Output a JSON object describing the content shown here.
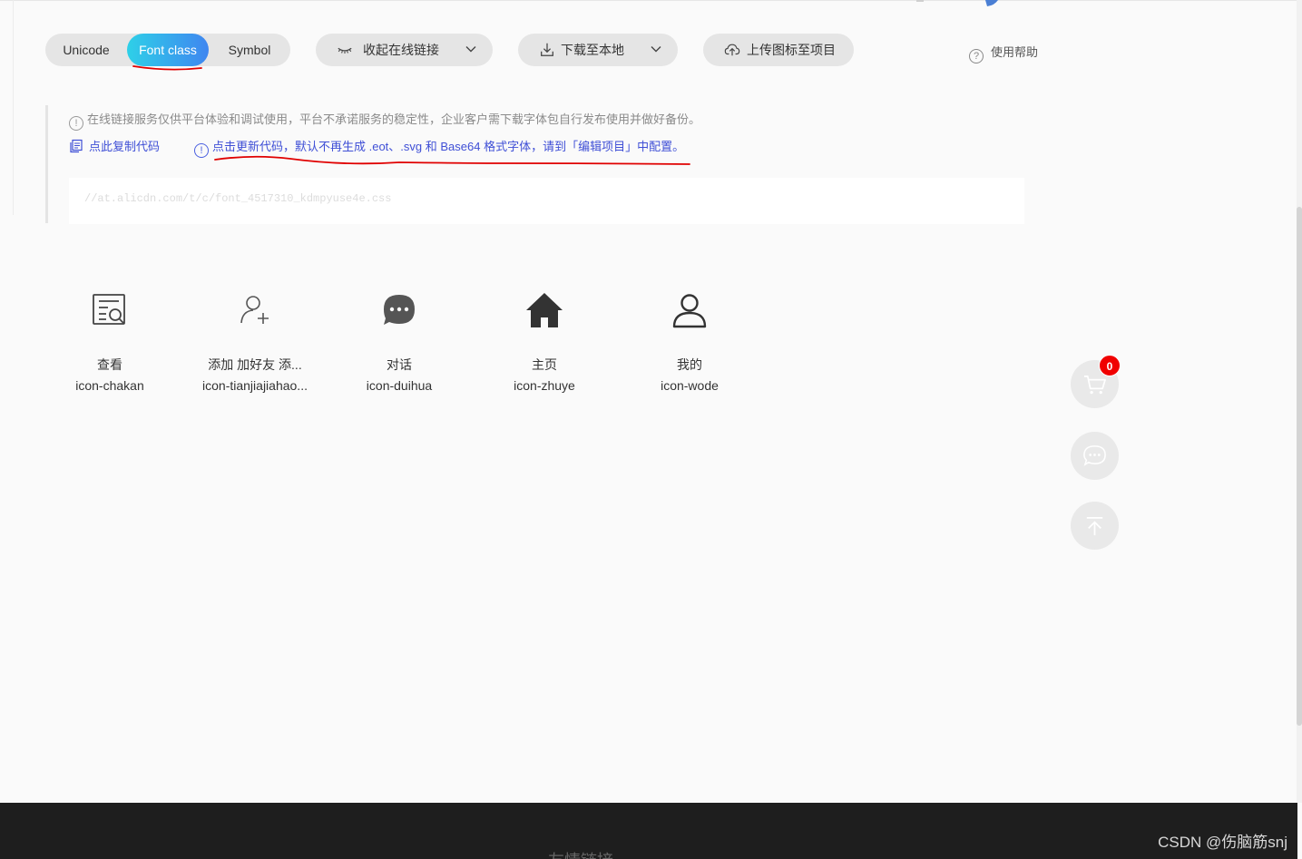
{
  "toolbar": {
    "tabs": [
      {
        "label": "Unicode"
      },
      {
        "label": "Font class"
      },
      {
        "label": "Symbol"
      }
    ],
    "collapse_label": "收起在线链接",
    "download_label": "下载至本地",
    "upload_label": "上传图标至项目",
    "help_label": "使用帮助"
  },
  "notice": {
    "info": "在线链接服务仅供平台体验和调试使用，平台不承诺服务的稳定性，企业客户需下载字体包自行发布使用并做好备份。",
    "copy_link": "点此复制代码",
    "update_link": "点击更新代码，默认不再生成 .eot、.svg 和 Base64 格式字体，请到「编辑项目」中配置。",
    "code": "//at.alicdn.com/t/c/font_4517310_kdmpyuse4e.css"
  },
  "icons": [
    {
      "name": "查看",
      "class": "icon-chakan",
      "icon": "view-icon"
    },
    {
      "name": "添加 加好友 添...",
      "class": "icon-tianjiajiahao...",
      "icon": "add-user-icon"
    },
    {
      "name": "对话",
      "class": "icon-duihua",
      "icon": "chat-icon"
    },
    {
      "name": "主页",
      "class": "icon-zhuye",
      "icon": "home-icon"
    },
    {
      "name": "我的",
      "class": "icon-wode",
      "icon": "user-icon"
    }
  ],
  "cart": {
    "count": "0"
  },
  "footer": {
    "title": "友情链接"
  },
  "watermark": "CSDN @伤脑筋snj",
  "colors": {
    "active_tab_start": "#2ed0e8",
    "active_tab_end": "#3f86f0",
    "link": "#3f4fd6",
    "annotation": "#e00000",
    "badge": "#f00000"
  }
}
